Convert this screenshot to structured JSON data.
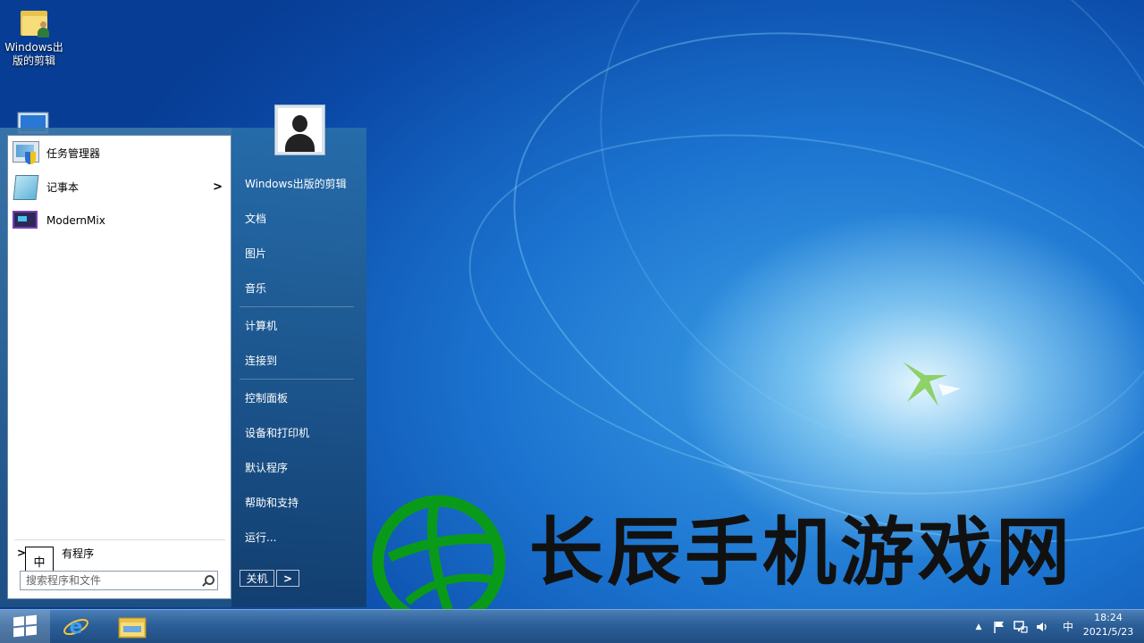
{
  "desktop": {
    "icons": [
      {
        "label": "Windows出版的剪辑"
      }
    ]
  },
  "start_menu": {
    "programs": [
      {
        "label": "任务管理器",
        "icon": "task-manager-icon",
        "has_submenu": false
      },
      {
        "label": "记事本",
        "icon": "notepad-icon",
        "has_submenu": true
      },
      {
        "label": "ModernMix",
        "icon": "modernmix-icon",
        "has_submenu": false
      }
    ],
    "all_programs_arrow": ">",
    "all_programs_label": "有程序",
    "search_placeholder": "搜索程序和文件",
    "right_items": [
      {
        "label": "Windows出版的剪辑"
      },
      {
        "label": "文档"
      },
      {
        "label": "图片"
      },
      {
        "label": "音乐"
      },
      {
        "label": "计算机"
      },
      {
        "label": "连接到"
      },
      {
        "label": "控制面板"
      },
      {
        "label": "设备和打印机"
      },
      {
        "label": "默认程序"
      },
      {
        "label": "帮助和支持"
      },
      {
        "label": "运行..."
      }
    ],
    "shutdown_label": "关机",
    "shutdown_arrow": ">",
    "submenu_arrow": ">"
  },
  "ime_indicator": "中",
  "watermark": {
    "text": "长辰手机游戏网",
    "color": "#0a9a1a"
  },
  "taskbar": {
    "tray_ime": "中",
    "tray_up_arrow": "▲",
    "time": "18:24",
    "date": "2021/5/23"
  },
  "colors": {
    "taskbar": "#2c5f98",
    "desktop": "#1b73cf"
  }
}
